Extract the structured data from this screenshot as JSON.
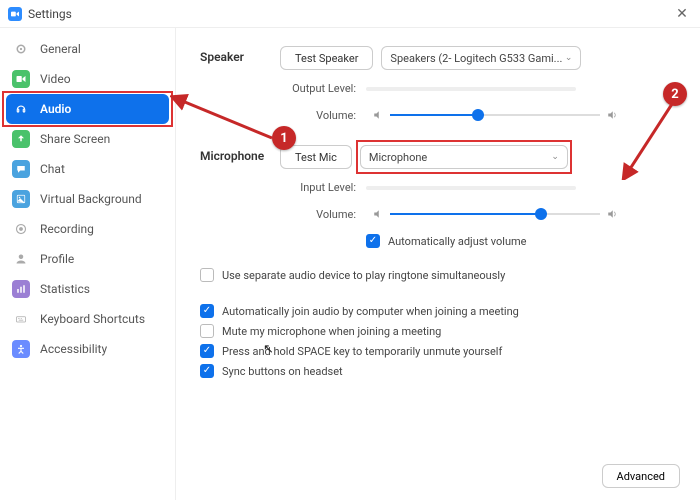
{
  "window": {
    "title": "Settings"
  },
  "sidebar": {
    "items": [
      {
        "label": "General",
        "icon": "gear"
      },
      {
        "label": "Video",
        "icon": "video"
      },
      {
        "label": "Audio",
        "icon": "headphones",
        "active": true
      },
      {
        "label": "Share Screen",
        "icon": "share"
      },
      {
        "label": "Chat",
        "icon": "chat"
      },
      {
        "label": "Virtual Background",
        "icon": "bg"
      },
      {
        "label": "Recording",
        "icon": "rec"
      },
      {
        "label": "Profile",
        "icon": "profile"
      },
      {
        "label": "Statistics",
        "icon": "stats"
      },
      {
        "label": "Keyboard Shortcuts",
        "icon": "kbd"
      },
      {
        "label": "Accessibility",
        "icon": "access"
      }
    ]
  },
  "speaker": {
    "section": "Speaker",
    "testBtn": "Test Speaker",
    "device": "Speakers (2- Logitech G533 Gami...",
    "outputLabel": "Output Level:",
    "volumeLabel": "Volume:",
    "volumePct": 42
  },
  "mic": {
    "section": "Microphone",
    "testBtn": "Test Mic",
    "device": "Microphone",
    "inputLabel": "Input Level:",
    "volumeLabel": "Volume:",
    "volumePct": 72,
    "autoAdjust": "Automatically adjust volume"
  },
  "opts": {
    "sep": "Use separate audio device to play ringtone simultaneously",
    "join": "Automatically join audio by computer when joining a meeting",
    "mute": "Mute my microphone when joining a meeting",
    "space": "Press and hold SPACE key to temporarily unmute yourself",
    "sync": "Sync buttons on headset"
  },
  "advanced": "Advanced",
  "annotations": {
    "c1": "1",
    "c2": "2"
  }
}
